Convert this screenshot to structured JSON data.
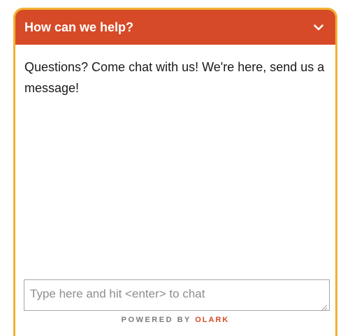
{
  "header": {
    "title": "How can we help?",
    "toggle_icon": "chevron-down-icon"
  },
  "messages": {
    "greeting": "Questions? Come chat with us! We're here, send us a message!"
  },
  "input": {
    "placeholder": "Type here and hit <enter> to chat",
    "value": ""
  },
  "footer": {
    "powered_by": "POWERED BY",
    "brand": "OLARK"
  },
  "colors": {
    "header_bg": "#d64a27",
    "border": "#f2b233",
    "brand": "#d64a27"
  }
}
